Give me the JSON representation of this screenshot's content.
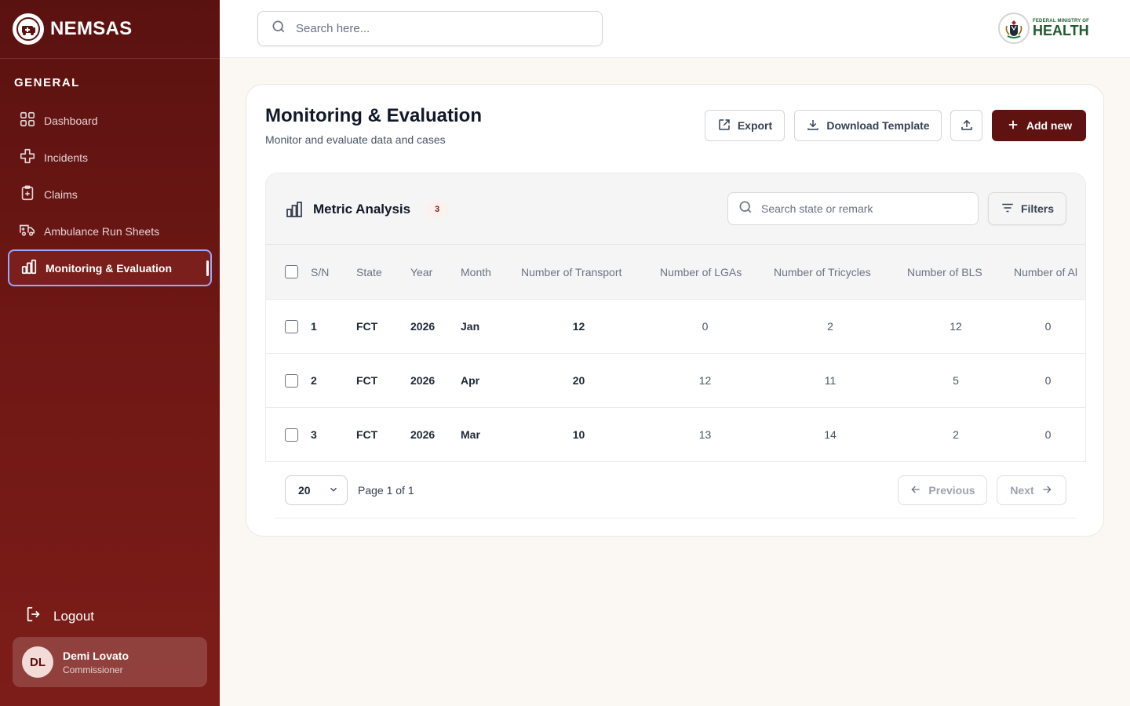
{
  "brand": {
    "name": "NEMSAS"
  },
  "sidebar": {
    "section_title": "GENERAL",
    "items": [
      {
        "label": "Dashboard",
        "icon": "grid-icon"
      },
      {
        "label": "Incidents",
        "icon": "medical-cross-icon"
      },
      {
        "label": "Claims",
        "icon": "clipboard-plus-icon"
      },
      {
        "label": "Ambulance Run Sheets",
        "icon": "ambulance-icon"
      },
      {
        "label": "Monitoring & Evaluation",
        "icon": "bar-chart-icon",
        "active": true
      }
    ],
    "logout_label": "Logout",
    "user": {
      "initials": "DL",
      "name": "Demi Lovato",
      "role": "Commissioner"
    }
  },
  "header": {
    "search_placeholder": "Search here...",
    "partner_logo": {
      "line1": "FEDERAL MINISTRY OF",
      "line2": "HEALTH"
    }
  },
  "page": {
    "title": "Monitoring & Evaluation",
    "subtitle": "Monitor and evaluate data and cases",
    "actions": {
      "export": "Export",
      "download_template": "Download Template",
      "add_new": "Add new"
    }
  },
  "panel": {
    "title": "Metric Analysis",
    "count": "3",
    "search_placeholder": "Search state or remark",
    "filters_label": "Filters"
  },
  "table": {
    "columns": [
      "S/N",
      "State",
      "Year",
      "Month",
      "Number of Transport",
      "Number of LGAs",
      "Number of Tricycles",
      "Number of BLS",
      "Number of Al"
    ],
    "rows": [
      [
        "1",
        "FCT",
        "2026",
        "Jan",
        "12",
        "0",
        "2",
        "12",
        "0"
      ],
      [
        "2",
        "FCT",
        "2026",
        "Apr",
        "20",
        "12",
        "11",
        "5",
        "0"
      ],
      [
        "3",
        "FCT",
        "2026",
        "Mar",
        "10",
        "13",
        "14",
        "2",
        "0"
      ]
    ]
  },
  "pagination": {
    "page_size": "20",
    "page_info": "Page 1 of 1",
    "previous": "Previous",
    "next": "Next"
  },
  "colors": {
    "brand_dark": "#5e1311",
    "sidebar": "#6e1714",
    "active_border": "#9aa8ff"
  }
}
